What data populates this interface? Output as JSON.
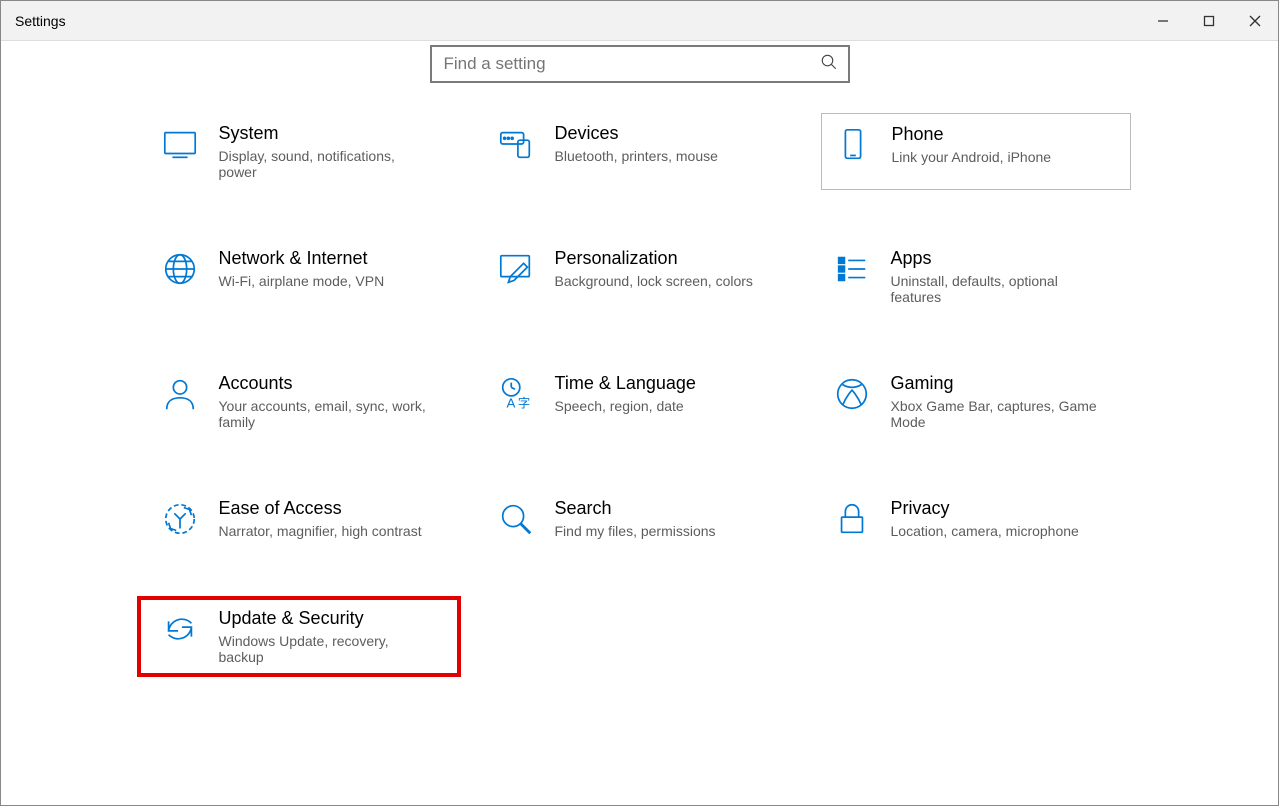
{
  "window": {
    "title": "Settings"
  },
  "search": {
    "placeholder": "Find a setting"
  },
  "tiles": [
    {
      "id": "system",
      "title": "System",
      "sub": "Display, sound, notifications, power"
    },
    {
      "id": "devices",
      "title": "Devices",
      "sub": "Bluetooth, printers, mouse"
    },
    {
      "id": "phone",
      "title": "Phone",
      "sub": "Link your Android, iPhone"
    },
    {
      "id": "network",
      "title": "Network & Internet",
      "sub": "Wi-Fi, airplane mode, VPN"
    },
    {
      "id": "personalization",
      "title": "Personalization",
      "sub": "Background, lock screen, colors"
    },
    {
      "id": "apps",
      "title": "Apps",
      "sub": "Uninstall, defaults, optional features"
    },
    {
      "id": "accounts",
      "title": "Accounts",
      "sub": "Your accounts, email, sync, work, family"
    },
    {
      "id": "time",
      "title": "Time & Language",
      "sub": "Speech, region, date"
    },
    {
      "id": "gaming",
      "title": "Gaming",
      "sub": "Xbox Game Bar, captures, Game Mode"
    },
    {
      "id": "ease",
      "title": "Ease of Access",
      "sub": "Narrator, magnifier, high contrast"
    },
    {
      "id": "search",
      "title": "Search",
      "sub": "Find my files, permissions"
    },
    {
      "id": "privacy",
      "title": "Privacy",
      "sub": "Location, camera, microphone"
    },
    {
      "id": "update",
      "title": "Update & Security",
      "sub": "Windows Update, recovery, backup"
    }
  ]
}
